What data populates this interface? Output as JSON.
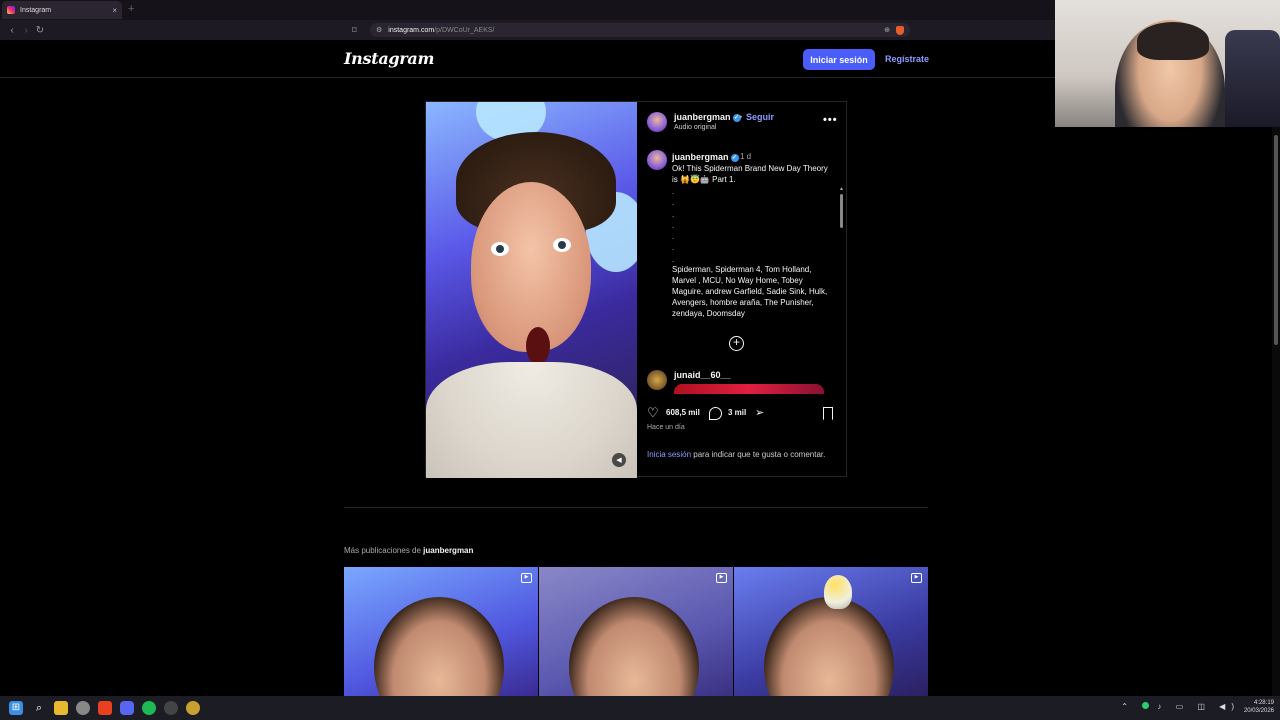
{
  "browser": {
    "tab_title": "Instagram",
    "tab_close": "×",
    "new_tab": "+",
    "url_host": "instagram.com",
    "url_path": "/p/DWCoUr_AEKS/"
  },
  "header": {
    "logo": "Instagram",
    "login_label": "Iniciar sesión",
    "signup_label": "Regístrate"
  },
  "post": {
    "username": "juanbergman",
    "separator": "•",
    "follow_label": "Seguir",
    "audio": "Audio original",
    "more": "•••",
    "caption_time": "1 d",
    "caption_text": "Ok! This Spiderman Brand New Day Theory is 🙀😇🤖 Part 1.",
    "caption_dots": ".\n.\n.\n.\n.\n.\n.",
    "caption_tags": "Spiderman, Spiderman 4, Tom Holland, Marvel , MCU, No Way Home, Tobey Maguire, andrew Garfield, Sadie Sink, Hulk, Avengers, hombre araña, The Punisher, zendaya, Doomsday",
    "comment_user": "junaid__60__",
    "likes": "608,5 mil",
    "comments": "3 mil",
    "time_ago": "Hace un día",
    "login_link": "Inicia sesión",
    "login_prompt": " para indicar que te gusta o comentar."
  },
  "more_section": {
    "prefix": "Más publicaciones de ",
    "username": "juanbergman"
  },
  "taskbar": {
    "time": "4:28:19",
    "date": "20/03/2026"
  },
  "colors": {
    "accent": "#4a5df9",
    "link": "#8c9bff",
    "verified": "#3897f0"
  }
}
